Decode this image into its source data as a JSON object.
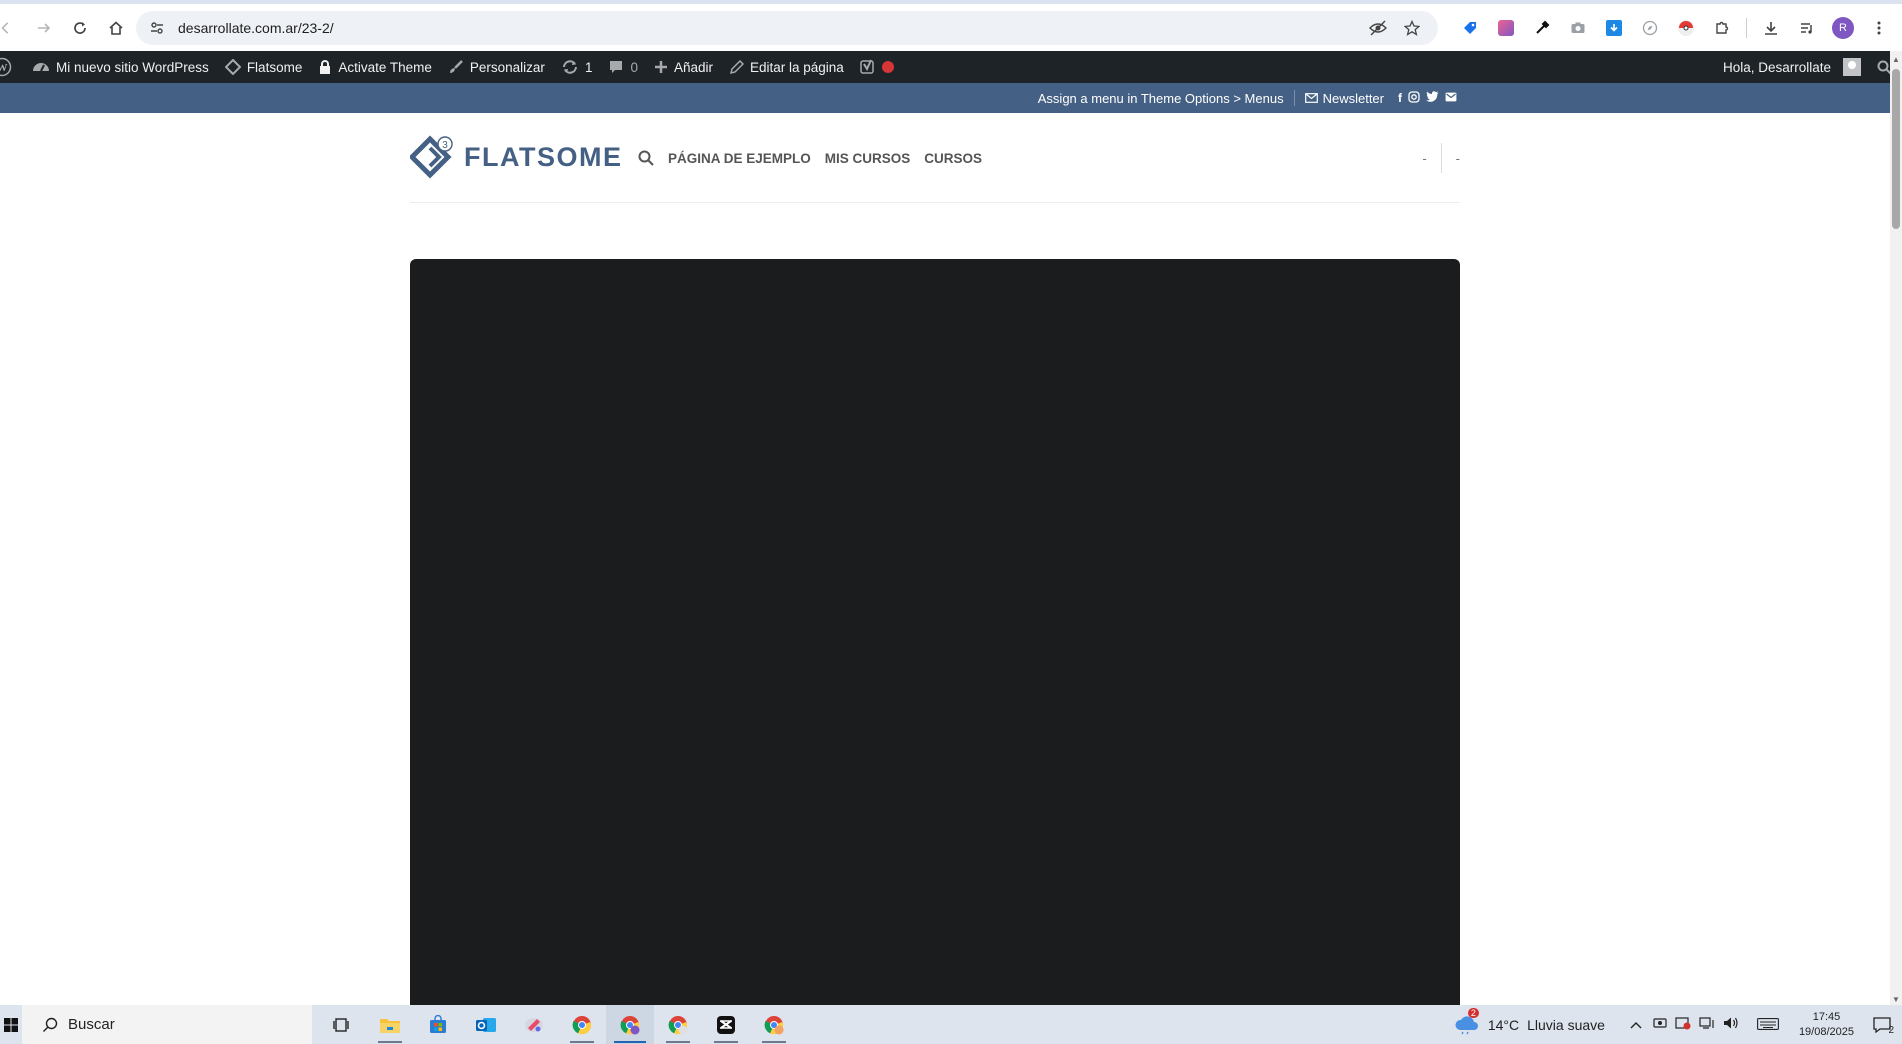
{
  "browser": {
    "url": "desarrollate.com.ar/23-2/",
    "profile_initial": "R",
    "extension_icons": [
      "tag-extension-icon",
      "gradient-extension-icon",
      "eyedropper-extension-icon",
      "camera-extension-icon",
      "download-extension-icon",
      "compass-extension-icon",
      "pokeball-extension-icon",
      "puzzle-extensions-icon"
    ],
    "toolbar_right_icons": [
      "downloads-icon",
      "media-controls-icon",
      "profile-avatar",
      "menu-icon"
    ]
  },
  "admin_bar": {
    "site_name": "Mi nuevo sitio WordPress",
    "theme": "Flatsome",
    "activate_theme": "Activate Theme",
    "customize": "Personalizar",
    "updates_count": "1",
    "comments_count": "0",
    "add_new": "Añadir",
    "edit_page": "Editar la página",
    "greeting": "Hola, Desarrollate"
  },
  "site_topbar": {
    "menu_notice": "Assign a menu in Theme Options > Menus",
    "newsletter": "Newsletter",
    "social": [
      "facebook-icon",
      "instagram-icon",
      "twitter-icon",
      "email-icon"
    ]
  },
  "header": {
    "logo_text": "FLATSOME",
    "logo_badge": "3",
    "nav": [
      "PÁGINA DE EJEMPLO",
      "MIS CURSOS",
      "CURSOS"
    ],
    "right_items": [
      "-",
      "-"
    ]
  },
  "colors": {
    "admin_bar": "#1d2327",
    "topbar": "#446084",
    "logo": "#446084",
    "video_bg": "#1b1c1e"
  },
  "taskbar": {
    "search_placeholder": "Buscar",
    "apps": [
      "task-view",
      "file-explorer",
      "microsoft-store",
      "outlook",
      "app-icon",
      "chrome",
      "chrome-profile",
      "chrome",
      "capcut",
      "chrome"
    ],
    "weather_temp": "14°C",
    "weather_desc": "Lluvia suave",
    "weather_badge": "2",
    "time": "17:45",
    "date": "19/08/2025",
    "notifications": "2"
  }
}
